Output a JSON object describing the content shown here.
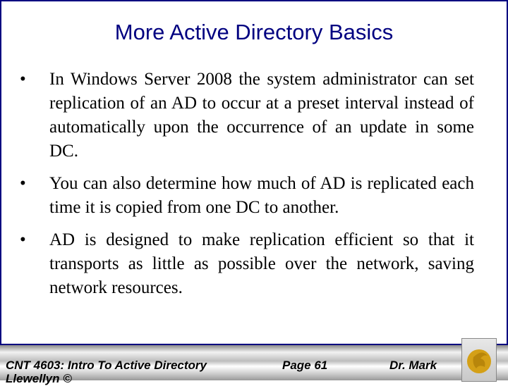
{
  "slide": {
    "title": "More Active Directory Basics",
    "bullet_glyph": "•",
    "bullets": [
      "In Windows Server 2008 the system administrator can set replication of an AD to occur at a preset interval instead of automatically upon the occurrence of an update in some DC.",
      "You can also determine how much of AD is replicated each time it is copied from one DC to another.",
      "AD is designed to make replication efficient so that it transports as little as possible over the network, saving network resources."
    ]
  },
  "footer": {
    "course": "CNT 4603: Intro To Active Directory",
    "page": "Page 61",
    "author": "Dr. Mark",
    "author_cont": "Llewellyn ©",
    "logo_icon": "pegasus-logo-icon"
  }
}
